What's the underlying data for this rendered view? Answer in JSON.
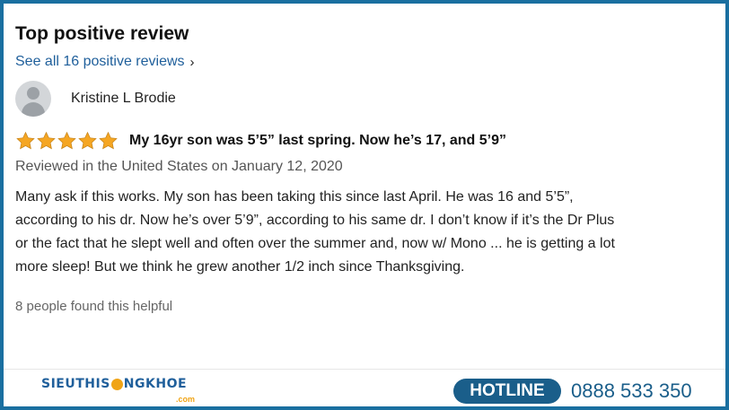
{
  "review": {
    "heading": "Top positive review",
    "see_all_link": "See all 16 positive reviews",
    "reviewer_name": "Kristine L Brodie",
    "rating": 5,
    "star_color": "#f5a623",
    "title": "My 16yr son was 5’5” last spring. Now he’s 17, and 5’9”",
    "meta": "Reviewed in the United States on January 12, 2020",
    "body": "Many ask if this works. My son has been taking this since last April. He was 16 and 5’5”, according to his dr. Now he’s over 5’9”, according to his same dr. I don’t know if it’s the Dr Plus or the fact that he slept well and often over the summer and, now w/ Mono ... he is getting a lot more sleep! But we think he grew another 1/2 inch since Thanksgiving.",
    "helpful": "8 people found this helpful"
  },
  "footer": {
    "logo_left": "SIEUTHIS",
    "logo_right": "NGKHOE",
    "logo_domain": ".com",
    "hotline_label": "HOTLINE",
    "hotline_number": "0888 533 350",
    "brand_color": "#1a5e8a",
    "accent_color": "#f0a416"
  }
}
